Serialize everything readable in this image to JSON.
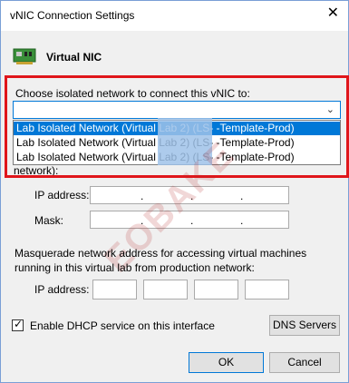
{
  "window": {
    "title": "vNIC Connection Settings",
    "close_glyph": "✕"
  },
  "section": {
    "title": "Virtual NIC",
    "icon": "network-card-icon"
  },
  "network": {
    "label": "Choose isolated network to connect this vNIC to:",
    "selected_value": "",
    "options": [
      "Lab Isolated Network (Virtual Lab 2) (LS-                -Template-Prod)",
      "Lab Isolated Network (Virtual Lab 2) (LS-                -Template-Prod)",
      "Lab Isolated Network (Virtual Lab 2) (LS-                -Template-Prod)"
    ],
    "hidden_label_tail": "network):"
  },
  "ip": {
    "ip_label": "IP address:",
    "mask_label": "Mask:",
    "dot": "."
  },
  "masquerade": {
    "text": "Masquerade network address for accessing virtual machines running in this virtual lab from production network:",
    "ip_label": "IP address:"
  },
  "dhcp": {
    "label": "Enable DHCP service on this interface",
    "checked": true,
    "check_glyph": "✓"
  },
  "buttons": {
    "dns": "DNS Servers",
    "ok": "OK",
    "cancel": "Cancel"
  },
  "colors": {
    "highlight_border": "#e0161b",
    "selection": "#0078d7"
  }
}
